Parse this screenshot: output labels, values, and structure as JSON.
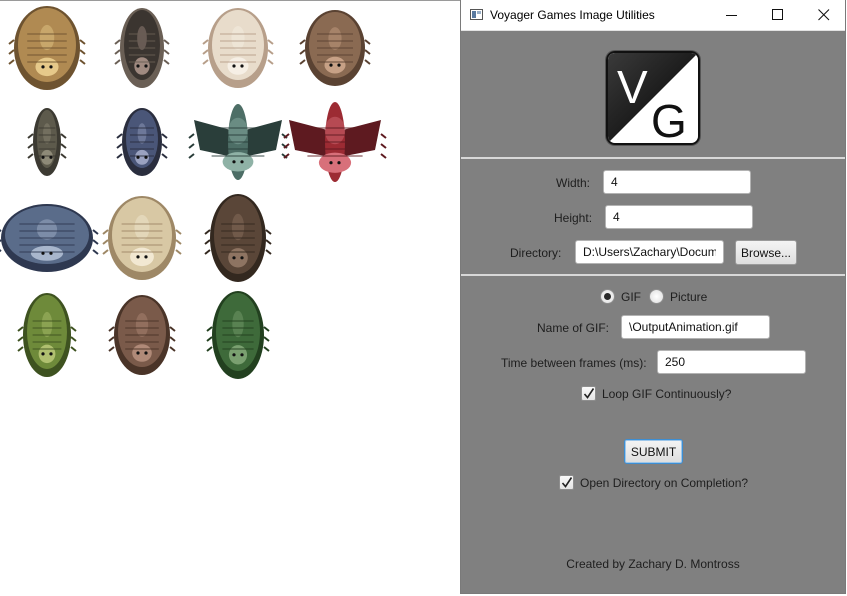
{
  "window": {
    "title": "Voyager Games Image Utilities",
    "controls": {
      "minimize": "minimize-icon",
      "maximize": "maximize-icon",
      "close": "close-icon"
    }
  },
  "logo": {
    "text_primary": "V",
    "text_secondary": "G"
  },
  "form": {
    "width_label": "Width:",
    "width_value": "4",
    "height_label": "Height:",
    "height_value": "4",
    "directory_label": "Directory:",
    "directory_value": "D:\\Users\\Zachary\\Docum",
    "browse_label": "Browse...",
    "output_type": {
      "options": [
        "GIF",
        "Picture"
      ],
      "selected": "GIF"
    },
    "gif_name_label": "Name of GIF:",
    "gif_name_value": "\\OutputAnimation.gif",
    "frame_time_label": "Time between frames (ms):",
    "frame_time_value": "250",
    "loop_label": "Loop GIF Continuously?",
    "loop_checked": true,
    "submit_label": "SUBMIT",
    "open_dir_label": "Open Directory on Completion?",
    "open_dir_checked": true
  },
  "footer": {
    "credit": "Created by Zachary D. Montross"
  },
  "sprite_sheet": {
    "grid": "4x4",
    "sprites": [
      {
        "name": "tan-horned-creature",
        "palette": [
          "#b08a52",
          "#6e5330",
          "#e6c98a"
        ]
      },
      {
        "name": "dark-armored-creature",
        "palette": [
          "#3b3530",
          "#6a5f55",
          "#a08a80"
        ]
      },
      {
        "name": "cream-slug-creature",
        "palette": [
          "#e8dccb",
          "#b79f8a",
          "#f6efe5"
        ]
      },
      {
        "name": "brown-spiked-creature",
        "palette": [
          "#8a6a52",
          "#5a4232",
          "#c7a186"
        ]
      },
      {
        "name": "grey-squid-creature",
        "palette": [
          "#5d5a4c",
          "#3c3a32",
          "#8e8a78"
        ]
      },
      {
        "name": "blue-beetle-creature",
        "palette": [
          "#4a5678",
          "#2a2e3e",
          "#9aa2c0"
        ]
      },
      {
        "name": "teal-winged-creature",
        "palette": [
          "#4d6e66",
          "#2a3e3a",
          "#8fb2a6"
        ]
      },
      {
        "name": "red-winged-creature",
        "palette": [
          "#9c2b33",
          "#5e1a20",
          "#d8707a"
        ]
      },
      {
        "name": "blue-crab-creature",
        "palette": [
          "#5a6c8a",
          "#2e3850",
          "#a8b6cc"
        ]
      },
      {
        "name": "beige-shell-creature",
        "palette": [
          "#d8c8a4",
          "#9e8866",
          "#f2e8d2"
        ]
      },
      {
        "name": "dark-brown-centipede",
        "palette": [
          "#5a4638",
          "#33281f",
          "#8e7462"
        ]
      },
      {
        "name": "empty-slot",
        "palette": []
      },
      {
        "name": "green-plant-creature",
        "palette": [
          "#6e8a3a",
          "#3e5220",
          "#b0c070"
        ]
      },
      {
        "name": "brown-egg-creature",
        "palette": [
          "#7a5a4a",
          "#4a3428",
          "#b08a78"
        ]
      },
      {
        "name": "dark-green-creature",
        "palette": [
          "#3e6a3a",
          "#22401f",
          "#7aa070"
        ]
      },
      {
        "name": "empty-slot",
        "palette": []
      }
    ]
  }
}
